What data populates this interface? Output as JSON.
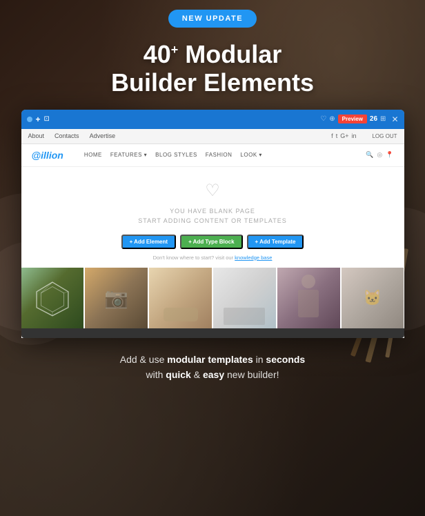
{
  "badge": {
    "label": "NEW UPDATE"
  },
  "hero": {
    "title_number": "40",
    "title_sup": "+",
    "title_rest": " Modular",
    "title_line2": "Builder Elements"
  },
  "browser": {
    "nav_items": [
      "About",
      "Contacts",
      "Advertise"
    ],
    "social_icons": [
      "f",
      "t",
      "g+",
      "in"
    ],
    "log_out": "LOG OUT",
    "count": "26",
    "preview_label": "Preview",
    "site_logo": "illion",
    "site_nav": [
      "HOME",
      "FEATURES ▾",
      "BLOG STYLES",
      "FASHION",
      "LOOK ▾"
    ]
  },
  "blank_page": {
    "title": "YOU HAVE BLANK PAGE",
    "subtitle": "START ADDING CONTENT OR TEMPLATES",
    "btn_add": "+ Add Element",
    "btn_type": "+ Add Type Block",
    "btn_template": "+ Add Template",
    "help_text": "Don't know where to start? visit our",
    "help_link": "knowledge base"
  },
  "bottom_description": {
    "line1_pre": "Add & use ",
    "line1_bold1": "modular templates",
    "line1_mid": " in ",
    "line1_bold2": "seconds",
    "line2_pre": "with ",
    "line2_bold1": "quick",
    "line2_mid": " & ",
    "line2_bold2": "easy",
    "line2_post": " new builder!"
  },
  "colors": {
    "accent_blue": "#2196f3",
    "badge_bg": "#2196f3",
    "browser_bar": "#1976d2"
  }
}
